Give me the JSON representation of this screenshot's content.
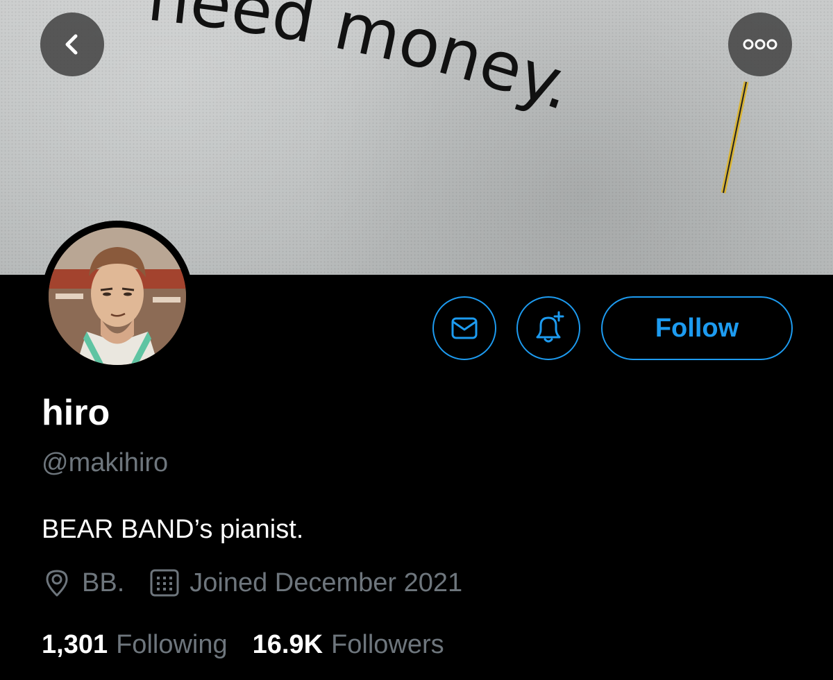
{
  "header": {
    "banner_text": "need money."
  },
  "profile": {
    "display_name": "hiro",
    "handle": "@makihiro",
    "bio": "BEAR BAND’s pianist.",
    "location": "BB.",
    "joined": "Joined December 2021",
    "following_count": "1,301",
    "following_label": "Following",
    "followers_count": "16.9K",
    "followers_label": "Followers"
  },
  "actions": {
    "follow_label": "Follow"
  },
  "icons": {
    "back": "chevron-left-icon",
    "more": "more-horizontal-icon",
    "message": "envelope-icon",
    "notify": "bell-plus-icon",
    "location": "location-pin-icon",
    "calendar": "calendar-icon"
  },
  "colors": {
    "accent": "#1d9bf0",
    "background": "#000000",
    "secondary_text": "#6e767d",
    "primary_text": "#ffffff"
  }
}
